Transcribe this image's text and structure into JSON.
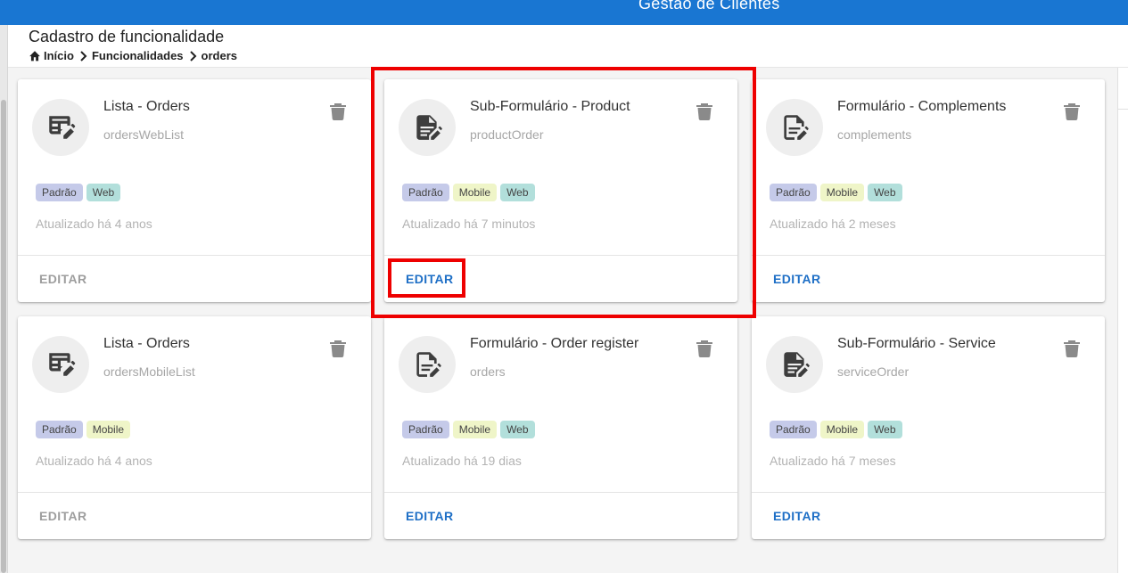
{
  "app": {
    "title": "Gestão de Clientes"
  },
  "header": {
    "title": "Cadastro de funcionalidade",
    "breadcrumb": [
      "Início",
      "Funcionalidades",
      "orders"
    ]
  },
  "cards": [
    {
      "title": "Lista - Orders",
      "subtitle": "ordersWebList",
      "icon": "table-edit-icon",
      "tags": [
        "Padrão",
        "Web"
      ],
      "updated": "Atualizado há 4 anos",
      "edit": "EDITAR",
      "edit_color": "#9e9e9e"
    },
    {
      "title": "Sub-Formulário - Product",
      "subtitle": "productOrder",
      "icon": "file-document-edit-icon",
      "tags": [
        "Padrão",
        "Mobile",
        "Web"
      ],
      "updated": "Atualizado há 7 minutos",
      "edit": "EDITAR",
      "edit_color": "#1e6fc6"
    },
    {
      "title": "Formulário - Complements",
      "subtitle": "complements",
      "icon": "file-document-edit-outline-icon",
      "tags": [
        "Padrão",
        "Mobile",
        "Web"
      ],
      "updated": "Atualizado há 2 meses",
      "edit": "EDITAR",
      "edit_color": "#1e6fc6"
    },
    {
      "title": "Lista - Orders",
      "subtitle": "ordersMobileList",
      "icon": "table-edit-icon",
      "tags": [
        "Padrão",
        "Mobile"
      ],
      "updated": "Atualizado há 4 anos",
      "edit": "EDITAR",
      "edit_color": "#9e9e9e"
    },
    {
      "title": "Formulário - Order register",
      "subtitle": "orders",
      "icon": "file-document-edit-outline-icon",
      "tags": [
        "Padrão",
        "Mobile",
        "Web"
      ],
      "updated": "Atualizado há 19 dias",
      "edit": "EDITAR",
      "edit_color": "#1e6fc6"
    },
    {
      "title": "Sub-Formulário - Service",
      "subtitle": "serviceOrder",
      "icon": "file-document-edit-icon",
      "tags": [
        "Padrão",
        "Mobile",
        "Web"
      ],
      "updated": "Atualizado há 7 meses",
      "edit": "EDITAR",
      "edit_color": "#1e6fc6"
    }
  ],
  "colors": {
    "appbar": "#1976d2",
    "highlight": "#ee0000",
    "tag_padrao": "#c5cae9",
    "tag_mobile": "#eff5c8",
    "tag_web": "#b2dfdb"
  }
}
